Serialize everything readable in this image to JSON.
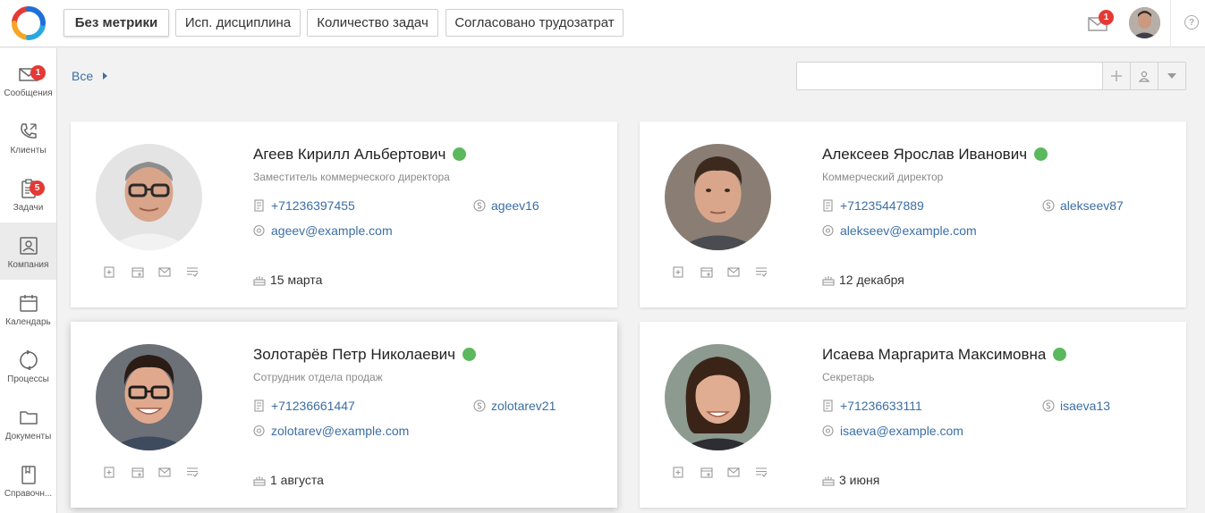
{
  "header": {
    "tabs": [
      {
        "label": "Без метрики",
        "active": true
      },
      {
        "label": "Исп. дисциплина",
        "active": false
      },
      {
        "label": "Количество задач",
        "active": false
      },
      {
        "label": "Согласовано трудозатрат",
        "active": false
      }
    ],
    "mail_badge": "1",
    "help_icon": "?"
  },
  "sidebar": {
    "items": [
      {
        "label": "Сообщения",
        "icon": "envelope-icon",
        "badge": "1"
      },
      {
        "label": "Клиенты",
        "icon": "phone-icon"
      },
      {
        "label": "Задачи",
        "icon": "clipboard-icon",
        "badge": "5"
      },
      {
        "label": "Компания",
        "icon": "company-icon",
        "active": true
      },
      {
        "label": "Календарь",
        "icon": "calendar-icon"
      },
      {
        "label": "Процессы",
        "icon": "cycle-icon"
      },
      {
        "label": "Документы",
        "icon": "folder-icon"
      },
      {
        "label": "Справочн...",
        "icon": "book-icon"
      }
    ]
  },
  "filter": {
    "breadcrumb": "Все",
    "search_placeholder": ""
  },
  "employees": [
    {
      "name": "Агеев Кирилл Альбертович",
      "position": "Заместитель коммерческого директора",
      "phone": "+71236397455",
      "skype": "ageev16",
      "email": "ageev@example.com",
      "birthday": "15 марта",
      "online": true
    },
    {
      "name": "Алексеев Ярослав Иванович",
      "position": "Коммерческий директор",
      "phone": "+71235447889",
      "skype": "alekseev87",
      "email": "alekseev@example.com",
      "birthday": "12 декабря",
      "online": true
    },
    {
      "name": "Золотарёв Петр Николаевич",
      "position": "Сотрудник отдела продаж",
      "phone": "+71236661447",
      "skype": "zolotarev21",
      "email": "zolotarev@example.com",
      "birthday": "1 августа",
      "online": true
    },
    {
      "name": "Исаева Маргарита Максимовна",
      "position": "Секретарь",
      "phone": "+71236633111",
      "skype": "isaeva13",
      "email": "isaeva@example.com",
      "birthday": "3 июня",
      "online": true
    }
  ],
  "colors": {
    "accent": "#3b6ea5",
    "online": "#5cb85c",
    "badge": "#e53935"
  }
}
